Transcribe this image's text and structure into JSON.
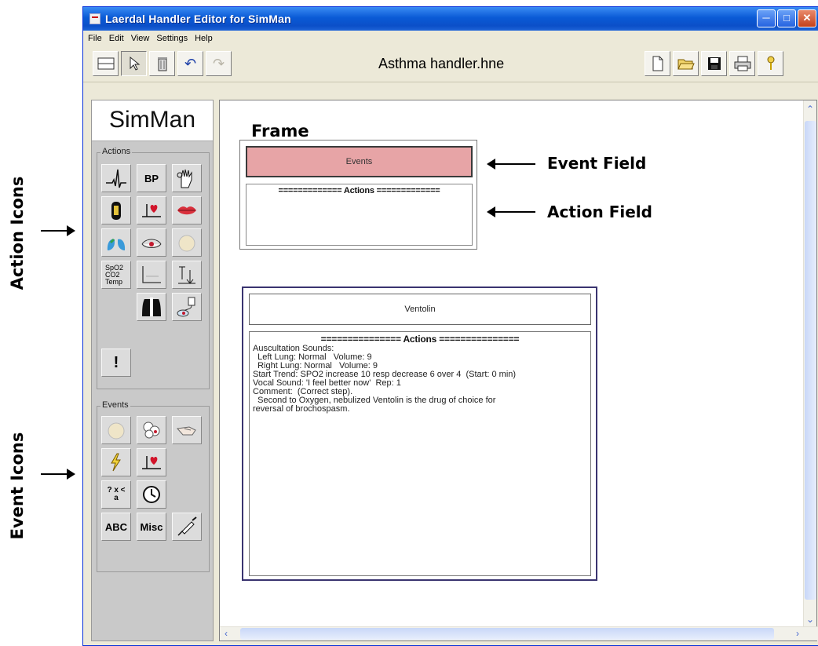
{
  "annotations": {
    "action_icons": "Action Icons",
    "event_icons": "Event Icons",
    "frame": "Frame",
    "event_field": "Event Field",
    "action_field": "Action Field"
  },
  "window": {
    "title": "Laerdal Handler Editor for SimMan",
    "menu": [
      "File",
      "Edit",
      "View",
      "Settings",
      "Help"
    ],
    "file_name": "Asthma handler.hne"
  },
  "toolbar": {
    "left_icons": [
      "frame-icon",
      "pointer-icon",
      "trash-icon",
      "undo-icon",
      "redo-icon"
    ],
    "right_icons": [
      "new-file-icon",
      "open-folder-icon",
      "save-icon",
      "print-icon",
      "help-icon"
    ]
  },
  "palette": {
    "brand": "SimMan",
    "actions_title": "Actions",
    "action_items": [
      {
        "name": "ecg-icon",
        "label": ""
      },
      {
        "name": "bp-icon",
        "label": "BP"
      },
      {
        "name": "hand-icon",
        "label": ""
      },
      {
        "name": "bottle-icon",
        "label": ""
      },
      {
        "name": "heart-stand-icon",
        "label": ""
      },
      {
        "name": "lips-icon",
        "label": ""
      },
      {
        "name": "lungs-icon",
        "label": ""
      },
      {
        "name": "eye-icon",
        "label": ""
      },
      {
        "name": "pupil-icon",
        "label": ""
      },
      {
        "name": "spo2-icon",
        "label": "SpO2 CO2 Temp"
      },
      {
        "name": "graph-icon",
        "label": ""
      },
      {
        "name": "trend-icon",
        "label": ""
      },
      {
        "name": "xray-icon",
        "label": ""
      },
      {
        "name": "iv-icon",
        "label": ""
      },
      {
        "name": "alert-icon",
        "label": "!"
      }
    ],
    "events_title": "Events",
    "event_items": [
      {
        "name": "pupil-event-icon",
        "label": ""
      },
      {
        "name": "blood-event-icon",
        "label": ""
      },
      {
        "name": "hand-event-icon",
        "label": ""
      },
      {
        "name": "shock-event-icon",
        "label": ""
      },
      {
        "name": "heart-event-icon",
        "label": ""
      },
      {
        "name": "condition-event-icon",
        "label": "? x < a"
      },
      {
        "name": "clock-event-icon",
        "label": ""
      },
      {
        "name": "abc-event-icon",
        "label": "ABC"
      },
      {
        "name": "misc-event-icon",
        "label": "Misc"
      },
      {
        "name": "syringe-event-icon",
        "label": ""
      }
    ]
  },
  "frame1": {
    "event_text": "Events",
    "actions_header": "============= Actions ============="
  },
  "frame2": {
    "event_text": "Ventolin",
    "actions_header": "=============== Actions ===============",
    "lines": [
      "Auscultation Sounds:",
      "  Left Lung: Normal   Volume: 9",
      "  Right Lung: Normal   Volume: 9",
      "Start Trend: SPO2 increase 10 resp decrease 6 over 4  (Start: 0 min)",
      "Vocal Sound: 'I feel better now'  Rep: 1",
      "Comment:  (Correct step).",
      "  Second to Oxygen, nebulized Ventolin is the drug of choice for",
      "reversal of brochospasm."
    ]
  },
  "colors": {
    "event_field": "#e7a4a6",
    "frame_border": "#3a3470",
    "titlebar": "#0a5ad6"
  }
}
